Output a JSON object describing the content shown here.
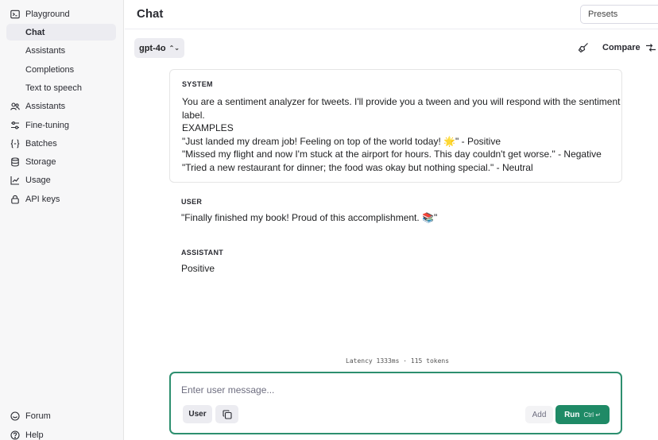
{
  "sidebar": {
    "items": [
      {
        "label": "Playground",
        "icon": "terminal-icon"
      },
      {
        "label": "Chat",
        "icon": ""
      },
      {
        "label": "Assistants",
        "icon": ""
      },
      {
        "label": "Completions",
        "icon": ""
      },
      {
        "label": "Text to speech",
        "icon": ""
      },
      {
        "label": "Assistants",
        "icon": "assistants-icon"
      },
      {
        "label": "Fine-tuning",
        "icon": "sliders-icon"
      },
      {
        "label": "Batches",
        "icon": "braces-icon"
      },
      {
        "label": "Storage",
        "icon": "database-icon"
      },
      {
        "label": "Usage",
        "icon": "chart-icon"
      },
      {
        "label": "API keys",
        "icon": "lock-icon"
      }
    ],
    "footer": [
      {
        "label": "Forum",
        "icon": "forum-icon"
      },
      {
        "label": "Help",
        "icon": "help-icon"
      }
    ]
  },
  "header": {
    "title": "Chat",
    "presets_placeholder": "Presets"
  },
  "toolbar": {
    "model": "gpt-4o",
    "compare_label": "Compare"
  },
  "system": {
    "role": "SYSTEM",
    "lines": [
      "You are a sentiment analyzer for tweets. I'll provide you a tween and you will respond with the sentiment",
      "label.",
      "EXAMPLES",
      "\"Just landed my dream job! Feeling on top of the world today! 🌟\" - Positive",
      "\"Missed my flight and now I'm stuck at the airport for hours. This day couldn't get worse.\" - Negative",
      "\"Tried a new restaurant for dinner; the food was okay but nothing special.\" - Neutral"
    ]
  },
  "messages": [
    {
      "role": "USER",
      "text": "\"Finally finished my book! Proud of this accomplishment. 📚\""
    },
    {
      "role": "ASSISTANT",
      "text": "Positive"
    }
  ],
  "latency": "Latency 1333ms · 115 tokens",
  "composer": {
    "placeholder": "Enter user message...",
    "role_label": "User",
    "add_label": "Add",
    "run_label": "Run",
    "run_shortcut": "Ctrl ↵"
  },
  "colors": {
    "accent": "#1f8a66",
    "composer_border": "#2d8f6f",
    "sidebar_bg": "#f7f7f8"
  }
}
